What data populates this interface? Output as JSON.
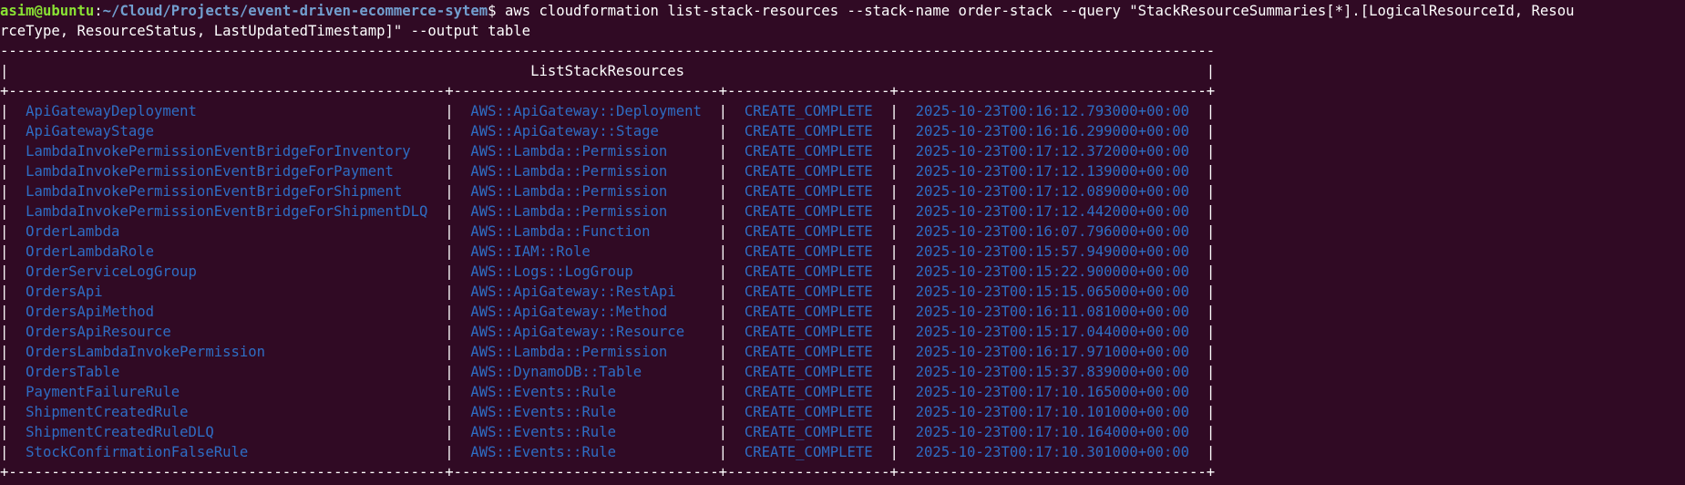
{
  "terminal": {
    "prompt": {
      "user_host": "asim@ubuntu",
      "separator": ":",
      "path": "~/Cloud/Projects/event-driven-ecommerce-sytem",
      "symbol": "$ "
    },
    "command_line_1": "aws cloudformation list-stack-resources --stack-name order-stack --query \"StackResourceSummaries[*].[LogicalResourceId, Resou",
    "command_line_2": "rceType, ResourceStatus, LastUpdatedTimestamp]\" --output table",
    "table": {
      "title": "ListStackResources",
      "rows": [
        [
          "ApiGatewayDeployment",
          "AWS::ApiGateway::Deployment",
          "CREATE_COMPLETE",
          "2025-10-23T00:16:12.793000+00:00"
        ],
        [
          "ApiGatewayStage",
          "AWS::ApiGateway::Stage",
          "CREATE_COMPLETE",
          "2025-10-23T00:16:16.299000+00:00"
        ],
        [
          "LambdaInvokePermissionEventBridgeForInventory",
          "AWS::Lambda::Permission",
          "CREATE_COMPLETE",
          "2025-10-23T00:17:12.372000+00:00"
        ],
        [
          "LambdaInvokePermissionEventBridgeForPayment",
          "AWS::Lambda::Permission",
          "CREATE_COMPLETE",
          "2025-10-23T00:17:12.139000+00:00"
        ],
        [
          "LambdaInvokePermissionEventBridgeForShipment",
          "AWS::Lambda::Permission",
          "CREATE_COMPLETE",
          "2025-10-23T00:17:12.089000+00:00"
        ],
        [
          "LambdaInvokePermissionEventBridgeForShipmentDLQ",
          "AWS::Lambda::Permission",
          "CREATE_COMPLETE",
          "2025-10-23T00:17:12.442000+00:00"
        ],
        [
          "OrderLambda",
          "AWS::Lambda::Function",
          "CREATE_COMPLETE",
          "2025-10-23T00:16:07.796000+00:00"
        ],
        [
          "OrderLambdaRole",
          "AWS::IAM::Role",
          "CREATE_COMPLETE",
          "2025-10-23T00:15:57.949000+00:00"
        ],
        [
          "OrderServiceLogGroup",
          "AWS::Logs::LogGroup",
          "CREATE_COMPLETE",
          "2025-10-23T00:15:22.900000+00:00"
        ],
        [
          "OrdersApi",
          "AWS::ApiGateway::RestApi",
          "CREATE_COMPLETE",
          "2025-10-23T00:15:15.065000+00:00"
        ],
        [
          "OrdersApiMethod",
          "AWS::ApiGateway::Method",
          "CREATE_COMPLETE",
          "2025-10-23T00:16:11.081000+00:00"
        ],
        [
          "OrdersApiResource",
          "AWS::ApiGateway::Resource",
          "CREATE_COMPLETE",
          "2025-10-23T00:15:17.044000+00:00"
        ],
        [
          "OrdersLambdaInvokePermission",
          "AWS::Lambda::Permission",
          "CREATE_COMPLETE",
          "2025-10-23T00:16:17.971000+00:00"
        ],
        [
          "OrdersTable",
          "AWS::DynamoDB::Table",
          "CREATE_COMPLETE",
          "2025-10-23T00:15:37.839000+00:00"
        ],
        [
          "PaymentFailureRule",
          "AWS::Events::Rule",
          "CREATE_COMPLETE",
          "2025-10-23T00:17:10.165000+00:00"
        ],
        [
          "ShipmentCreatedRule",
          "AWS::Events::Rule",
          "CREATE_COMPLETE",
          "2025-10-23T00:17:10.101000+00:00"
        ],
        [
          "ShipmentCreatedRuleDLQ",
          "AWS::Events::Rule",
          "CREATE_COMPLETE",
          "2025-10-23T00:17:10.164000+00:00"
        ],
        [
          "StockConfirmationFalseRule",
          "AWS::Events::Rule",
          "CREATE_COMPLETE",
          "2025-10-23T00:17:10.301000+00:00"
        ]
      ]
    }
  },
  "colors": {
    "background": "#300a24",
    "prompt_user": "#8ae234",
    "prompt_path": "#729fcf",
    "text": "#ffffff",
    "table_cell_text": "#2e6dc4"
  }
}
